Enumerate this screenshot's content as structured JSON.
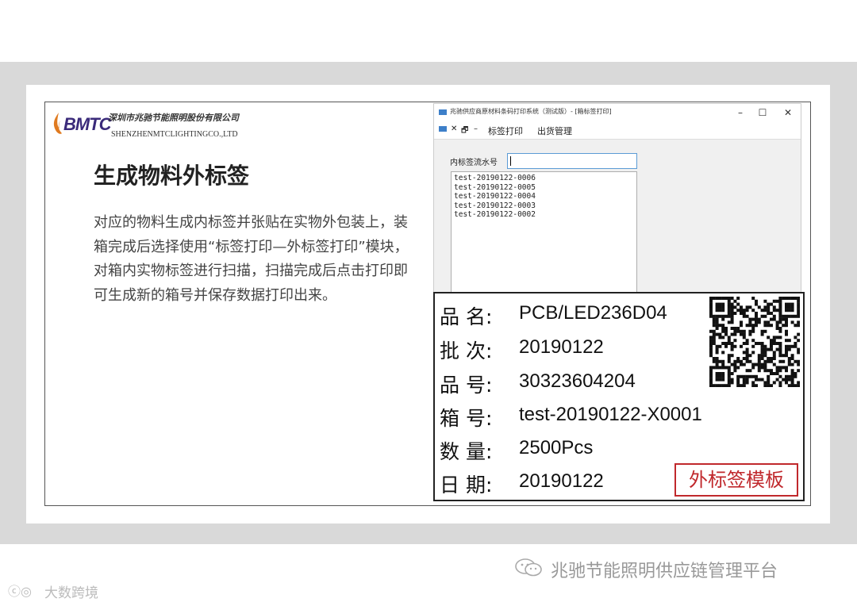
{
  "slide": {
    "logo": {
      "mark": "BMTC",
      "company_cn": "深圳市兆驰节能照明股份有限公司",
      "company_en": "SHENZHENMTCLIGHTINGCO.,LTD"
    },
    "title": "生成物料外标签",
    "body": "对应的物料生成内标签并张贴在实物外包装上，装箱完成后选择使用“标签打印—外标签打印”模块，对箱内实物标签进行扫描，扫描完成后点击打印即可生成新的箱号并保存数据打印出来。"
  },
  "window": {
    "title": "兆驰供应商原材料条码打印系统（测试版）- [箱标签打印]",
    "controls": {
      "minimize": "–",
      "maximize": "☐",
      "close": "✕"
    },
    "mdi_icons": {
      "close": "✕",
      "restore": "🗗",
      "minimize": "–"
    },
    "menu": [
      "标签打印",
      "出货管理"
    ],
    "serial_label": "内标签流水号",
    "serial_value": "",
    "list_items": [
      "test-20190122-0006",
      "test-20190122-0005",
      "test-20190122-0004",
      "test-20190122-0003",
      "test-20190122-0002"
    ]
  },
  "label": {
    "rows": [
      {
        "key": "品 名:",
        "value": "PCB/LED236D04"
      },
      {
        "key": "批 次:",
        "value": "20190122"
      },
      {
        "key": "品 号:",
        "value": "30323604204"
      },
      {
        "key": "箱 号:",
        "value": "test-20190122-X0001"
      },
      {
        "key": "数 量:",
        "value": "2500Pcs"
      },
      {
        "key": "日 期:",
        "value": "20190122"
      }
    ],
    "template_tag": "外标签模板"
  },
  "footer": {
    "left_icon": "ⓒ◎",
    "left_text": "大数跨境",
    "right_text": "兆驰节能照明供应链管理平台"
  },
  "colors": {
    "accent_red": "#c0282c",
    "window_blue": "#3d7fc9",
    "logo_purple": "#3a2a7a"
  }
}
